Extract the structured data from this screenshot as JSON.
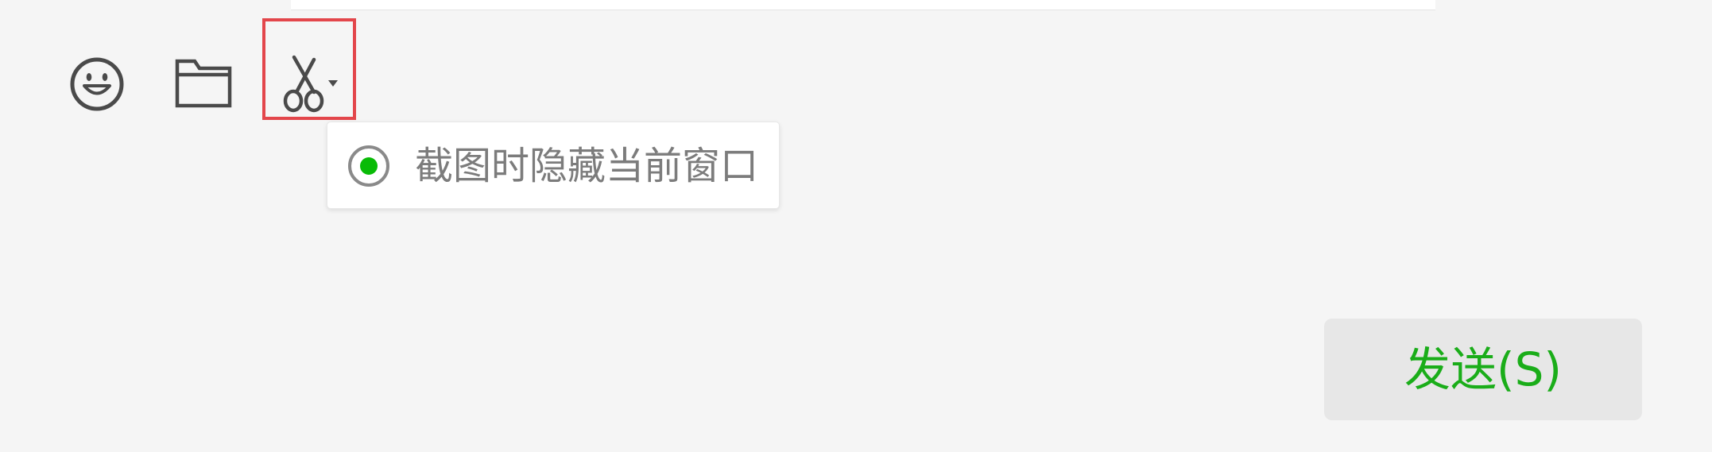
{
  "toolbar": {
    "icons": {
      "emoji": "smiley-face-icon",
      "file": "folder-icon",
      "screenshot": "scissors-icon",
      "screenshot_dropdown": "chevron-down-icon"
    },
    "highlight_color": "#e3464b"
  },
  "screenshot_menu": {
    "options": [
      {
        "label": "截图时隐藏当前窗口",
        "selected": true
      }
    ],
    "selected_color": "#09bb07"
  },
  "composer": {
    "send_label": "发送(S)",
    "send_text_color": "#1aad19"
  }
}
